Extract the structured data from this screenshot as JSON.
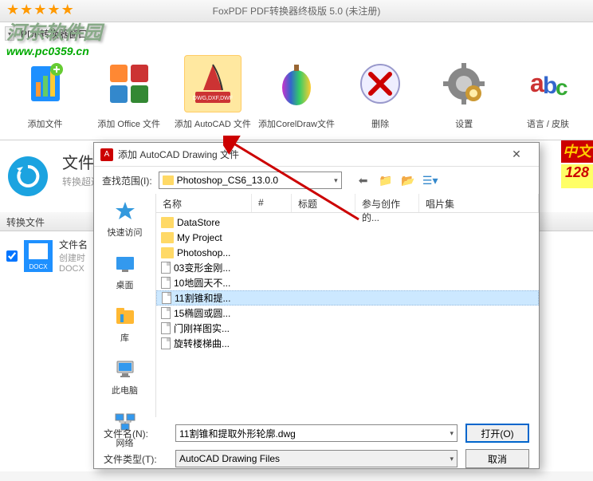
{
  "watermark": {
    "site_name": "河东软件园",
    "url": "www.pc0359.cn"
  },
  "title_bar": {
    "title": "FoxPDF PDF转换器终极版 5.0 (未注册)"
  },
  "menu_bar": {
    "label": "PDF转换器窗口"
  },
  "ribbon": {
    "items": [
      {
        "label": "添加文件",
        "icon": "add-file"
      },
      {
        "label": "添加 Office 文件",
        "icon": "office"
      },
      {
        "label": "添加 AutoCAD 文件",
        "icon": "autocad"
      },
      {
        "label": "添加CorelDraw文件",
        "icon": "coreldraw"
      },
      {
        "label": "删除",
        "icon": "delete"
      },
      {
        "label": "设置",
        "icon": "settings"
      },
      {
        "label": "语言 / 皮肤",
        "icon": "language"
      }
    ]
  },
  "convert": {
    "title": "文件",
    "subtitle": "转换超过"
  },
  "right_badge": {
    "text1": "中文",
    "text2": "128"
  },
  "file_section": {
    "header": "转换文件",
    "filename": "文件名",
    "created": "创建时",
    "ext": "DOCX"
  },
  "dialog": {
    "title": "添加 AutoCAD Drawing 文件",
    "search_label": "查找范围(I):",
    "current_folder": "Photoshop_CS6_13.0.0",
    "sidebar": [
      {
        "label": "快速访问",
        "icon": "quick"
      },
      {
        "label": "桌面",
        "icon": "desktop"
      },
      {
        "label": "库",
        "icon": "library"
      },
      {
        "label": "此电脑",
        "icon": "computer"
      },
      {
        "label": "网络",
        "icon": "network"
      }
    ],
    "columns": {
      "name": "名称",
      "num": "#",
      "title": "标题",
      "participants": "参与创作的...",
      "album": "唱片集"
    },
    "files": [
      {
        "name": "DataStore",
        "type": "folder"
      },
      {
        "name": "My Project",
        "type": "folder"
      },
      {
        "name": "Photoshop...",
        "type": "folder"
      },
      {
        "name": "03变形金刚...",
        "type": "file"
      },
      {
        "name": "10地圆天不...",
        "type": "file"
      },
      {
        "name": "11割锥和提...",
        "type": "file",
        "selected": true
      },
      {
        "name": "15椭圆或圆...",
        "type": "file"
      },
      {
        "name": "门刚祥图实...",
        "type": "file"
      },
      {
        "name": "旋转楼梯曲...",
        "type": "file"
      }
    ],
    "filename_label": "文件名(N):",
    "filename_value": "11割锥和提取外形轮廓.dwg",
    "filetype_label": "文件类型(T):",
    "filetype_value": "AutoCAD Drawing Files",
    "open_btn": "打开(O)",
    "cancel_btn": "取消"
  }
}
